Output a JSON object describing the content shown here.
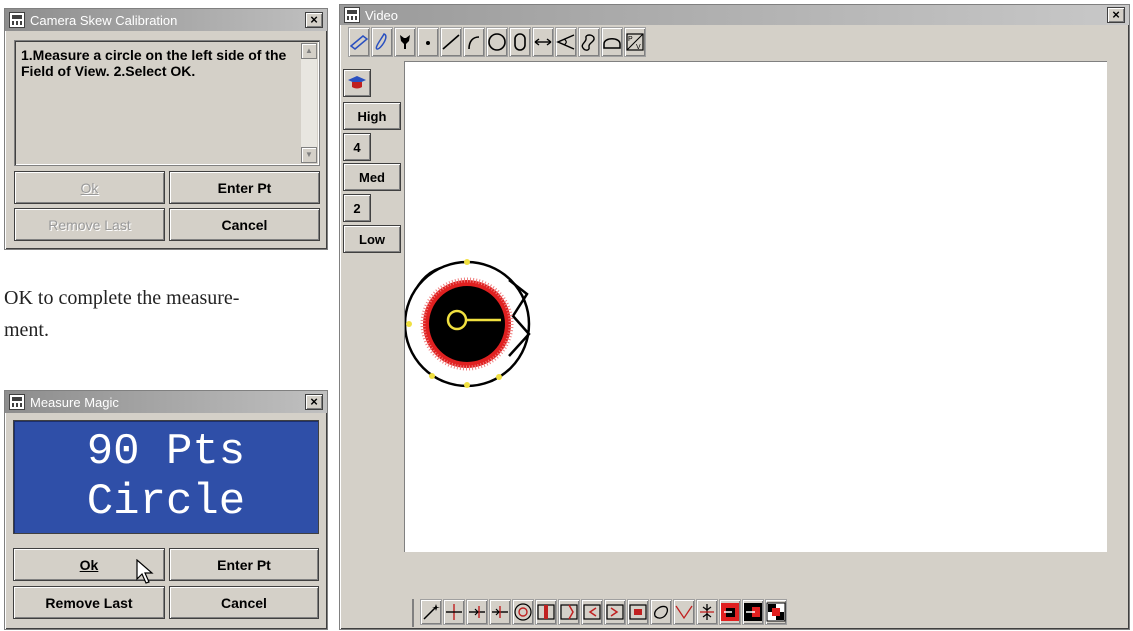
{
  "skew_dialog": {
    "title": "Camera Skew Calibration",
    "message": "1.Measure a circle on the left side of the Field of View. 2.Select OK.",
    "ok_label": "Ok",
    "enter_pt_label": "Enter Pt",
    "remove_last_label": "Remove Last",
    "cancel_label": "Cancel"
  },
  "body_text": "OK to complete the measure-\nment.",
  "magic_dialog": {
    "title": "Measure Magic",
    "display_line1": "90 Pts",
    "display_line2": "Circle",
    "ok_label": "Ok",
    "enter_pt_label": "Enter Pt",
    "remove_last_label": "Remove Last",
    "cancel_label": "Cancel"
  },
  "video_window": {
    "title": "Video",
    "zoom_buttons": [
      "High",
      "4",
      "Med",
      "2",
      "Low"
    ],
    "top_tools": [
      "box-select-icon",
      "freehand-icon",
      "probe-icon",
      "point-icon",
      "line-icon",
      "arc-icon",
      "circle-icon",
      "slot-icon",
      "distance-icon",
      "angle-icon",
      "contour-icon",
      "profile-icon",
      "pv-icon"
    ],
    "bottom_tools": [
      "magic-wand-icon",
      "crosshair-icon",
      "edge-right-icon",
      "edge-left-icon",
      "target-icon",
      "box-edge-icon",
      "box-edge-2-icon",
      "box-edge-3-icon",
      "box-edge-4-icon",
      "box-edge-5-icon",
      "blob-icon",
      "v-icon",
      "bisect-icon",
      "threshold-1-icon",
      "threshold-2-icon",
      "threshold-3-icon"
    ]
  },
  "colors": {
    "display_blue": "#2f4fa8",
    "circle_red": "#e02020",
    "measure_yellow": "#f0e040"
  }
}
